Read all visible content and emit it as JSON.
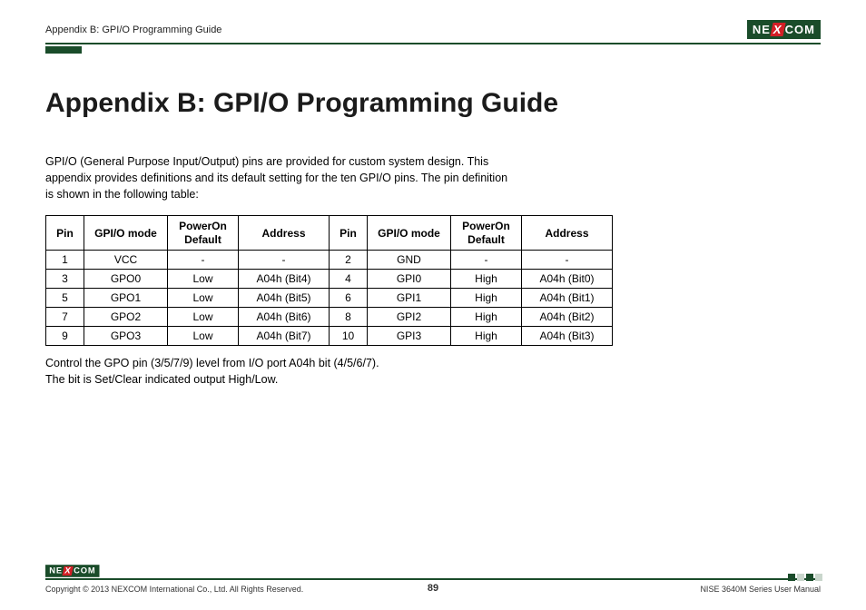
{
  "header": {
    "breadcrumb": "Appendix B: GPI/O Programming Guide"
  },
  "brand": {
    "name_pre": "NE",
    "name_x": "X",
    "name_post": "COM"
  },
  "title": "Appendix B: GPI/O Programming Guide",
  "intro": "GPI/O (General Purpose Input/Output) pins are provided for custom system design. This appendix provides definitions and its default setting for the ten GPI/O pins. The pin definition is shown in the following table:",
  "table": {
    "headers": {
      "pin": "Pin",
      "mode": "GPI/O mode",
      "pod1": "PowerOn",
      "pod2": "Default",
      "addr": "Address"
    },
    "rows": [
      {
        "pinL": "1",
        "modeL": "VCC",
        "podL": "-",
        "addrL": "-",
        "pinR": "2",
        "modeR": "GND",
        "podR": "-",
        "addrR": "-"
      },
      {
        "pinL": "3",
        "modeL": "GPO0",
        "podL": "Low",
        "addrL": "A04h (Bit4)",
        "pinR": "4",
        "modeR": "GPI0",
        "podR": "High",
        "addrR": "A04h (Bit0)"
      },
      {
        "pinL": "5",
        "modeL": "GPO1",
        "podL": "Low",
        "addrL": "A04h (Bit5)",
        "pinR": "6",
        "modeR": "GPI1",
        "podR": "High",
        "addrR": "A04h (Bit1)"
      },
      {
        "pinL": "7",
        "modeL": "GPO2",
        "podL": "Low",
        "addrL": "A04h (Bit6)",
        "pinR": "8",
        "modeR": "GPI2",
        "podR": "High",
        "addrR": "A04h (Bit2)"
      },
      {
        "pinL": "9",
        "modeL": "GPO3",
        "podL": "Low",
        "addrL": "A04h (Bit7)",
        "pinR": "10",
        "modeR": "GPI3",
        "podR": "High",
        "addrR": "A04h (Bit3)"
      }
    ]
  },
  "note_l1": "Control the GPO pin (3/5/7/9) level from I/O port A04h bit (4/5/6/7).",
  "note_l2": "The bit is Set/Clear indicated output High/Low.",
  "footer": {
    "copyright": "Copyright © 2013 NEXCOM International Co., Ltd. All Rights Reserved.",
    "page": "89",
    "manual": "NISE 3640M Series User Manual"
  }
}
